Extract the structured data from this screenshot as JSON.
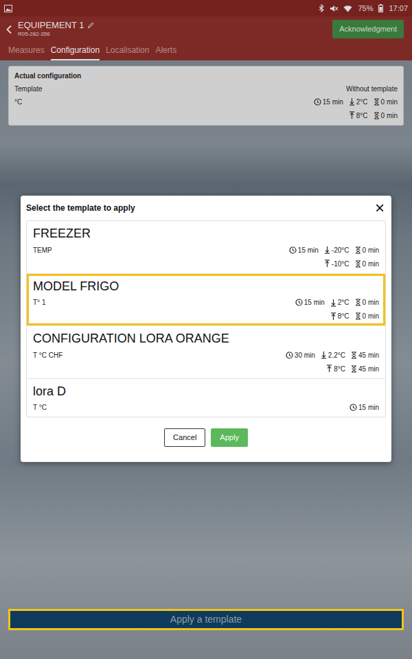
{
  "status_bar": {
    "battery": "75%",
    "time": "17:07"
  },
  "header": {
    "title": "EQUIPEMENT 1",
    "subtitle": "R05-282-356",
    "button": "Acknowledgment"
  },
  "tabs": [
    {
      "label": "Measures",
      "selected": false
    },
    {
      "label": "Configuration",
      "selected": true
    },
    {
      "label": "Localisation",
      "selected": false
    },
    {
      "label": "Alerts",
      "selected": false
    }
  ],
  "current_config": {
    "title": "Actual configuration",
    "template_label": "Template",
    "template_value": "Without template",
    "unit": "°C",
    "period": "15 min",
    "low": "2°C",
    "low_delay": "0 min",
    "high": "8°C",
    "high_delay": "0 min"
  },
  "modal": {
    "title": "Select the template to apply",
    "close": "×",
    "templates": [
      {
        "name": "FREEZER",
        "sensor": "TEMP",
        "period": "15 min",
        "low": "-20°C",
        "low_delay": "0 min",
        "high": "-10°C",
        "high_delay": "0 min",
        "selected": false
      },
      {
        "name": "MODEL FRIGO",
        "sensor": "T° 1",
        "period": "15 min",
        "low": "2°C",
        "low_delay": "0 min",
        "high": "8°C",
        "high_delay": "0 min",
        "selected": true
      },
      {
        "name": "CONFIGURATION LORA ORANGE",
        "sensor": "T °C CHF",
        "period": "30 min",
        "low": "2.2°C",
        "low_delay": "45 min",
        "high": "8°C",
        "high_delay": "45 min",
        "selected": false
      },
      {
        "name": "lora D",
        "sensor": "T °C",
        "period": "15 min",
        "selected": false
      }
    ],
    "cancel": "Cancel",
    "apply": "Apply"
  },
  "apply_bar": {
    "label": "Apply a template",
    "highlighted": true
  }
}
